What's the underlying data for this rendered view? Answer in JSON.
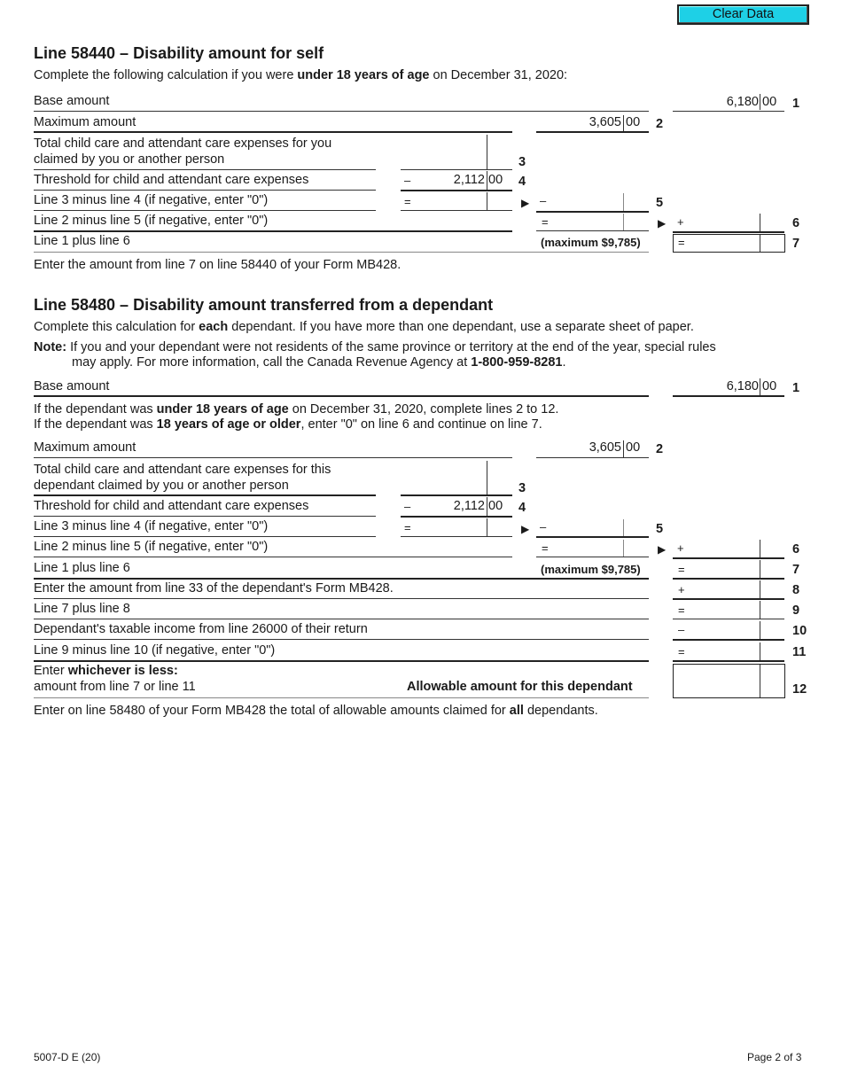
{
  "toolbar": {
    "clear_data_label": "Clear Data"
  },
  "section1": {
    "title": "Line 58440 – Disability amount for self",
    "intro_pre": "Complete the following calculation if you were ",
    "intro_bold": "under 18 years of age",
    "intro_post": " on December 31, 2020:",
    "rows": {
      "base": {
        "label": "Base amount",
        "dollars": "6,180",
        "cents": "00",
        "line": "1"
      },
      "max": {
        "label": "Maximum amount",
        "dollars": "3,605",
        "cents": "00",
        "line": "2"
      },
      "expenses": {
        "label_1": "Total child care and attendant care expenses for you",
        "label_2": "claimed by you or another person",
        "line": "3"
      },
      "threshold": {
        "label": "Threshold for child and attendant care expenses",
        "sign": "–",
        "dollars": "2,112",
        "cents": "00",
        "line": "4"
      },
      "l3m4": {
        "label": "Line 3 minus line 4 (if negative, enter \"0\")",
        "sign": "=",
        "arrow_sign": "–",
        "line": "5"
      },
      "l2m5": {
        "label": "Line 2 minus line 5 (if negative, enter \"0\")",
        "sign": "=",
        "arrow_sign": "+",
        "line": "6"
      },
      "l1p6": {
        "label": "Line 1 plus line 6",
        "max_note": "(maximum $9,785)",
        "sign": "=",
        "line": "7"
      }
    },
    "footer_note": "Enter the amount from line 7 on line 58440 of your Form MB428."
  },
  "section2": {
    "title": "Line 58480 – Disability amount transferred from a dependant",
    "intro_pre": "Complete this calculation for ",
    "intro_bold": "each",
    "intro_post": " dependant. If you have more than one dependant, use a separate sheet of paper.",
    "note_label": "Note:",
    "note_line1": " If you and your dependant were not residents of the same province or territory at the end of the year, special rules",
    "note_line2_pre": "may apply. For more information, call the Canada Revenue Agency at ",
    "note_phone": "1-800-959-8281",
    "note_line2_post": ".",
    "base": {
      "label": "Base amount",
      "dollars": "6,180",
      "cents": "00",
      "line": "1"
    },
    "cond1_pre": "If the dependant was ",
    "cond1_bold": "under 18 years of age",
    "cond1_post": " on December 31, 2020, complete lines 2 to 12.",
    "cond2_pre": "If the dependant was ",
    "cond2_bold": "18 years of age or older",
    "cond2_post": ", enter \"0\" on line 6 and continue on line 7.",
    "rows": {
      "max": {
        "label": "Maximum amount",
        "dollars": "3,605",
        "cents": "00",
        "line": "2"
      },
      "expenses": {
        "label_1": "Total child care and attendant care expenses for this",
        "label_2": "dependant claimed by you or another person",
        "line": "3"
      },
      "threshold": {
        "label": "Threshold for child and attendant care expenses",
        "sign": "–",
        "dollars": "2,112",
        "cents": "00",
        "line": "4"
      },
      "l3m4": {
        "label": "Line 3 minus line 4 (if negative, enter \"0\")",
        "sign": "=",
        "arrow_sign": "–",
        "line": "5"
      },
      "l2m5": {
        "label": "Line 2 minus line 5 (if negative, enter \"0\")",
        "sign": "=",
        "arrow_sign": "+",
        "line": "6"
      },
      "l1p6": {
        "label": "Line 1 plus line 6",
        "max_note": "(maximum $9,785)",
        "sign": "=",
        "line": "7"
      },
      "line33": {
        "label": "Enter the amount from line 33 of the dependant's Form MB428.",
        "sign": "+",
        "line": "8"
      },
      "l7p8": {
        "label": "Line 7 plus line 8",
        "sign": "=",
        "line": "9"
      },
      "taxable": {
        "label": "Dependant's taxable income from line 26000 of their return",
        "sign": "–",
        "line": "10"
      },
      "l9m10": {
        "label": "Line 9 minus line 10 (if negative, enter \"0\")",
        "sign": "=",
        "line": "11"
      },
      "lesser": {
        "label_pre": "Enter ",
        "label_bold": "whichever is less:",
        "label_2": "amount from line 7 or line 11",
        "allowable": "Allowable amount for this dependant",
        "line": "12"
      }
    },
    "footer_pre": "Enter on line 58480 of your Form MB428 the total of allowable amounts claimed for ",
    "footer_bold": "all",
    "footer_post": " dependants."
  },
  "page_footer": {
    "form_id": "5007-D E (20)",
    "page": "Page 2 of 3"
  }
}
